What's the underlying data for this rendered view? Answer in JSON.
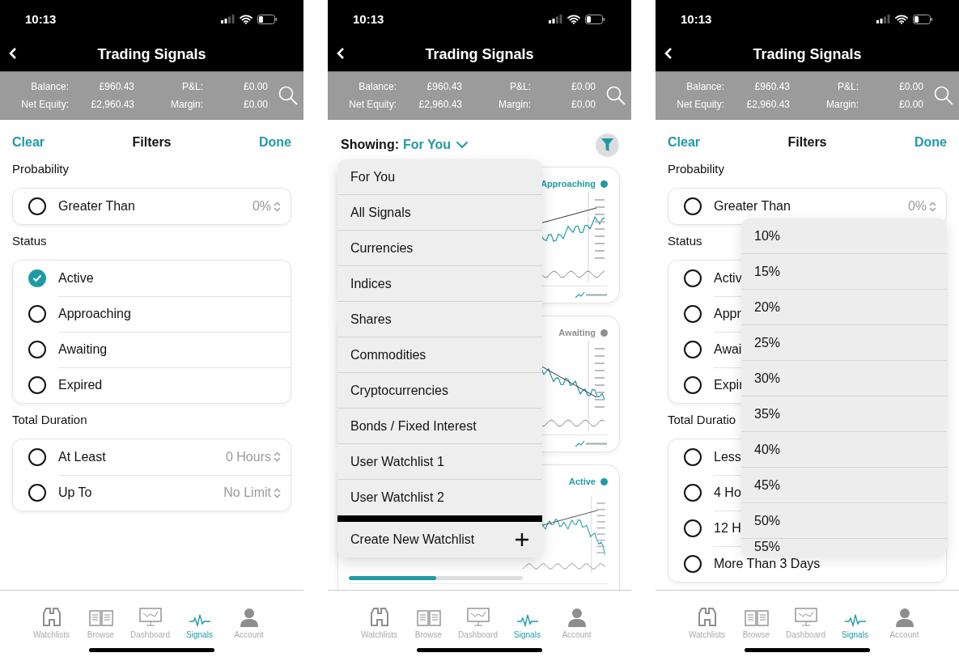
{
  "screens": [
    {
      "kind": "filters",
      "status_bar": {
        "time": "10:13"
      },
      "title": "Trading Signals",
      "account": [
        {
          "label": "Balance:",
          "value": "£960.43"
        },
        {
          "label": "P&L:",
          "value": "£0.00"
        },
        {
          "label": "Net Equity:",
          "value": "£2,960.43"
        },
        {
          "label": "Margin:",
          "value": "£0.00"
        }
      ],
      "filters": {
        "clear": "Clear",
        "title": "Filters",
        "done": "Done",
        "sections": [
          {
            "title": "Probability",
            "rows": [
              {
                "label": "Greater Than",
                "checked": false,
                "value": "0%"
              }
            ]
          },
          {
            "title": "Status",
            "rows": [
              {
                "label": "Active",
                "checked": true
              },
              {
                "label": "Approaching",
                "checked": false
              },
              {
                "label": "Awaiting",
                "checked": false
              },
              {
                "label": "Expired",
                "checked": false
              }
            ]
          },
          {
            "title": "Total Duration",
            "rows": [
              {
                "label": "At Least",
                "checked": false,
                "value": "0 Hours"
              },
              {
                "label": "Up To",
                "checked": false,
                "value": "No Limit"
              }
            ]
          }
        ]
      },
      "tab_bar": [
        {
          "label": "Watchlists",
          "selected": false
        },
        {
          "label": "Browse",
          "selected": false
        },
        {
          "label": "Dashboard",
          "selected": false
        },
        {
          "label": "Signals",
          "selected": true
        },
        {
          "label": "Account",
          "selected": false
        }
      ]
    },
    {
      "kind": "signals",
      "status_bar": {
        "time": "10:13"
      },
      "title": "Trading Signals",
      "account": [
        {
          "label": "Balance:",
          "value": "£960.43"
        },
        {
          "label": "P&L:",
          "value": "£0.00"
        },
        {
          "label": "Net Equity:",
          "value": "£2,960.43"
        },
        {
          "label": "Margin:",
          "value": "£0.00"
        }
      ],
      "signals": {
        "showing_label": "Showing:",
        "showing_value": "For You",
        "cards": [
          {
            "status": "Approaching",
            "color": "#1f9aa5"
          },
          {
            "status": "Awaiting",
            "color": "#8e8e8e"
          },
          {
            "status": "Active",
            "color": "#1f9aa5",
            "progress": {
              "level": 0.5
            }
          }
        ],
        "menu": {
          "items": [
            "For You",
            "All Signals",
            "Currencies",
            "Indices",
            "Shares",
            "Commodities",
            "Cryptocurrencies",
            "Bonds / Fixed Interest",
            "User Watchlist 1",
            "User Watchlist 2"
          ],
          "create": "Create New Watchlist"
        }
      },
      "tab_bar": [
        {
          "label": "Watchlists",
          "selected": false
        },
        {
          "label": "Browse",
          "selected": false
        },
        {
          "label": "Dashboard",
          "selected": false
        },
        {
          "label": "Signals",
          "selected": true
        },
        {
          "label": "Account",
          "selected": false
        }
      ]
    },
    {
      "kind": "filters",
      "status_bar": {
        "time": "10:13"
      },
      "title": "Trading Signals",
      "account": [
        {
          "label": "Balance:",
          "value": "£960.43"
        },
        {
          "label": "P&L:",
          "value": "£0.00"
        },
        {
          "label": "Net Equity:",
          "value": "£2,960.43"
        },
        {
          "label": "Margin:",
          "value": "£0.00"
        }
      ],
      "filters": {
        "clear": "Clear",
        "title": "Filters",
        "done": "Done",
        "sections": [
          {
            "title": "Probability",
            "rows": [
              {
                "label": "Greater Than",
                "checked": false,
                "value": "0%"
              }
            ]
          },
          {
            "title": "Status",
            "rows": [
              {
                "label": "Activ",
                "checked": false
              },
              {
                "label": "Appr",
                "checked": false
              },
              {
                "label": "Awai",
                "checked": false
              },
              {
                "label": "Expir",
                "checked": false
              }
            ]
          },
          {
            "title": "Total Duratio",
            "rows": [
              {
                "label": "Less",
                "checked": false
              },
              {
                "label": "4 Ho",
                "checked": false
              },
              {
                "label": "12 H",
                "checked": false
              },
              {
                "label": "More Than 3 Days",
                "checked": false
              }
            ]
          }
        ]
      },
      "picker": {
        "options": [
          "10%",
          "15%",
          "20%",
          "25%",
          "30%",
          "35%",
          "40%",
          "45%",
          "50%",
          "55%"
        ]
      },
      "tab_bar": [
        {
          "label": "Watchlists",
          "selected": false
        },
        {
          "label": "Browse",
          "selected": false
        },
        {
          "label": "Dashboard",
          "selected": false
        },
        {
          "label": "Signals",
          "selected": true
        },
        {
          "label": "Account",
          "selected": false
        }
      ]
    }
  ]
}
